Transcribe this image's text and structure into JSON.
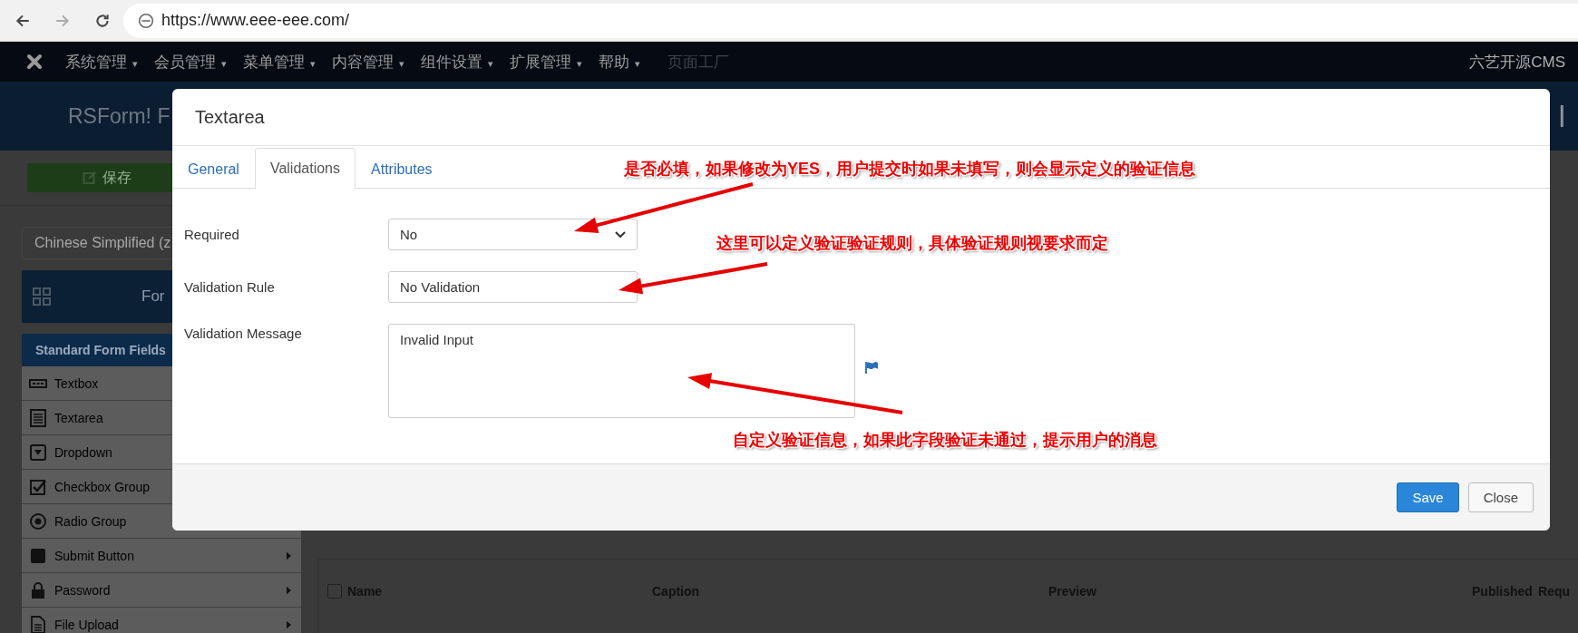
{
  "browser": {
    "url": "https://www.eee-eee.com/"
  },
  "nav": {
    "items": [
      {
        "label": "系统管理",
        "caret": "▾",
        "disabled": false
      },
      {
        "label": "会员管理",
        "caret": "▾",
        "disabled": false
      },
      {
        "label": "菜单管理",
        "caret": "▾",
        "disabled": false
      },
      {
        "label": "内容管理",
        "caret": "▾",
        "disabled": false
      },
      {
        "label": "组件设置",
        "caret": "▾",
        "disabled": false
      },
      {
        "label": "扩展管理",
        "caret": "▾",
        "disabled": false
      },
      {
        "label": "帮助",
        "caret": "▾",
        "disabled": false
      },
      {
        "label": "页面工厂",
        "disabled": true
      }
    ],
    "right_text": "六艺开源CMS"
  },
  "header": {
    "title": "RSForm! F",
    "right_fragment": "l"
  },
  "sidebar": {
    "save_button": "保存",
    "language": "Chinese Simplified (z",
    "forms_label": "For",
    "section": "Standard Form Fields",
    "fields": [
      {
        "label": "Textbox",
        "kind": "textbox"
      },
      {
        "label": "Textarea",
        "kind": "textarea"
      },
      {
        "label": "Dropdown",
        "kind": "dropdown"
      },
      {
        "label": "Checkbox Group",
        "kind": "checkbox"
      },
      {
        "label": "Radio Group",
        "kind": "radio"
      },
      {
        "label": "Submit Button",
        "kind": "submit",
        "submenu": true
      },
      {
        "label": "Password",
        "kind": "password",
        "submenu": true
      },
      {
        "label": "File Upload",
        "kind": "file",
        "submenu": true
      }
    ]
  },
  "table": {
    "checked": false,
    "columns": [
      "Name",
      "Caption",
      "Preview",
      "Published",
      "Requ"
    ]
  },
  "modal": {
    "title": "Textarea",
    "tabs": [
      {
        "label": "General",
        "selected": false
      },
      {
        "label": "Validations",
        "selected": true
      },
      {
        "label": "Attributes",
        "selected": false
      }
    ],
    "fields": [
      {
        "label": "Required",
        "kind": "select",
        "value": "No"
      },
      {
        "label": "Validation Rule",
        "kind": "text",
        "value": "No Validation"
      },
      {
        "label": "Validation Message",
        "kind": "textarea",
        "value": "Invalid Input"
      }
    ],
    "buttons": [
      {
        "label": "Save",
        "kind": "primary"
      },
      {
        "label": "Close",
        "kind": "default"
      }
    ]
  },
  "annotations": [
    {
      "text": "是否必填，如果修改为YES，用户提交时如果未填写，则会显示定义的验证信息"
    },
    {
      "text": "这里可以定义验证验证规则，具体验证规则视要求而定"
    },
    {
      "text": "自定义验证信息，如果此字段验证未通过，提示用户的消息"
    }
  ]
}
